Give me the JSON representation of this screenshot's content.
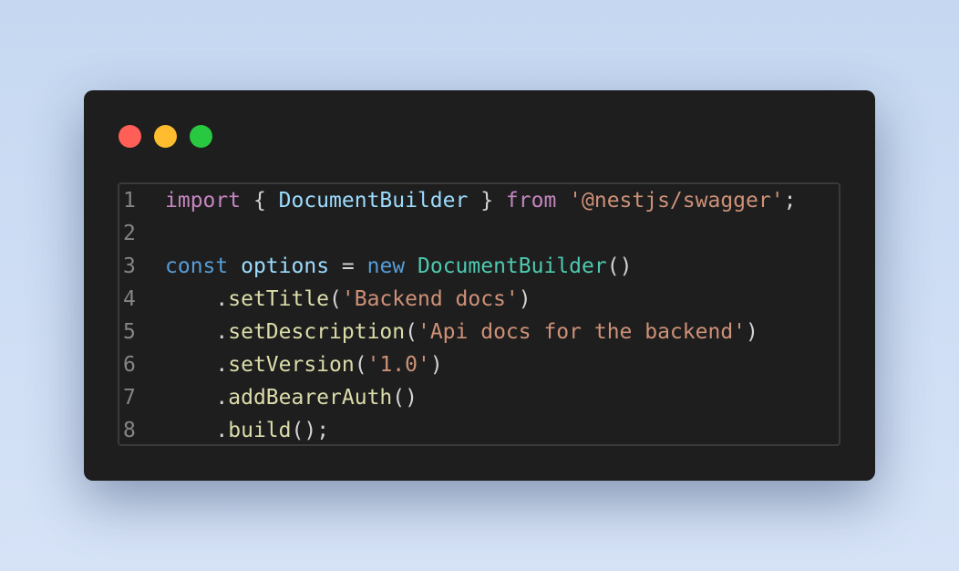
{
  "window": {
    "controls": [
      {
        "name": "close",
        "color": "#ff5f57"
      },
      {
        "name": "minimize",
        "color": "#febc2e"
      },
      {
        "name": "maximize",
        "color": "#28c840"
      }
    ]
  },
  "code": {
    "lines": [
      {
        "number": "1",
        "tokens": [
          {
            "text": "import",
            "type": "kw"
          },
          {
            "text": " { ",
            "type": "pun"
          },
          {
            "text": "DocumentBuilder",
            "type": "var"
          },
          {
            "text": " } ",
            "type": "pun"
          },
          {
            "text": "from",
            "type": "kw"
          },
          {
            "text": " ",
            "type": "pun"
          },
          {
            "text": "'@nestjs/swagger'",
            "type": "str"
          },
          {
            "text": ";",
            "type": "pun"
          }
        ]
      },
      {
        "number": "2",
        "tokens": []
      },
      {
        "number": "3",
        "tokens": [
          {
            "text": "const",
            "type": "dec"
          },
          {
            "text": " ",
            "type": "pun"
          },
          {
            "text": "options",
            "type": "var"
          },
          {
            "text": " = ",
            "type": "pun"
          },
          {
            "text": "new",
            "type": "dec"
          },
          {
            "text": " ",
            "type": "pun"
          },
          {
            "text": "DocumentBuilder",
            "type": "cls"
          },
          {
            "text": "()",
            "type": "pun"
          }
        ]
      },
      {
        "number": "4",
        "tokens": [
          {
            "text": "    .",
            "type": "pun"
          },
          {
            "text": "setTitle",
            "type": "fn"
          },
          {
            "text": "(",
            "type": "pun"
          },
          {
            "text": "'Backend docs'",
            "type": "str"
          },
          {
            "text": ")",
            "type": "pun"
          }
        ]
      },
      {
        "number": "5",
        "tokens": [
          {
            "text": "    .",
            "type": "pun"
          },
          {
            "text": "setDescription",
            "type": "fn"
          },
          {
            "text": "(",
            "type": "pun"
          },
          {
            "text": "'Api docs for the backend'",
            "type": "str"
          },
          {
            "text": ")",
            "type": "pun"
          }
        ]
      },
      {
        "number": "6",
        "tokens": [
          {
            "text": "    .",
            "type": "pun"
          },
          {
            "text": "setVersion",
            "type": "fn"
          },
          {
            "text": "(",
            "type": "pun"
          },
          {
            "text": "'1.0'",
            "type": "str"
          },
          {
            "text": ")",
            "type": "pun"
          }
        ]
      },
      {
        "number": "7",
        "tokens": [
          {
            "text": "    .",
            "type": "pun"
          },
          {
            "text": "addBearerAuth",
            "type": "fn"
          },
          {
            "text": "()",
            "type": "pun"
          }
        ]
      },
      {
        "number": "8",
        "tokens": [
          {
            "text": "    .",
            "type": "pun"
          },
          {
            "text": "build",
            "type": "fn"
          },
          {
            "text": "();",
            "type": "pun"
          }
        ]
      }
    ]
  }
}
